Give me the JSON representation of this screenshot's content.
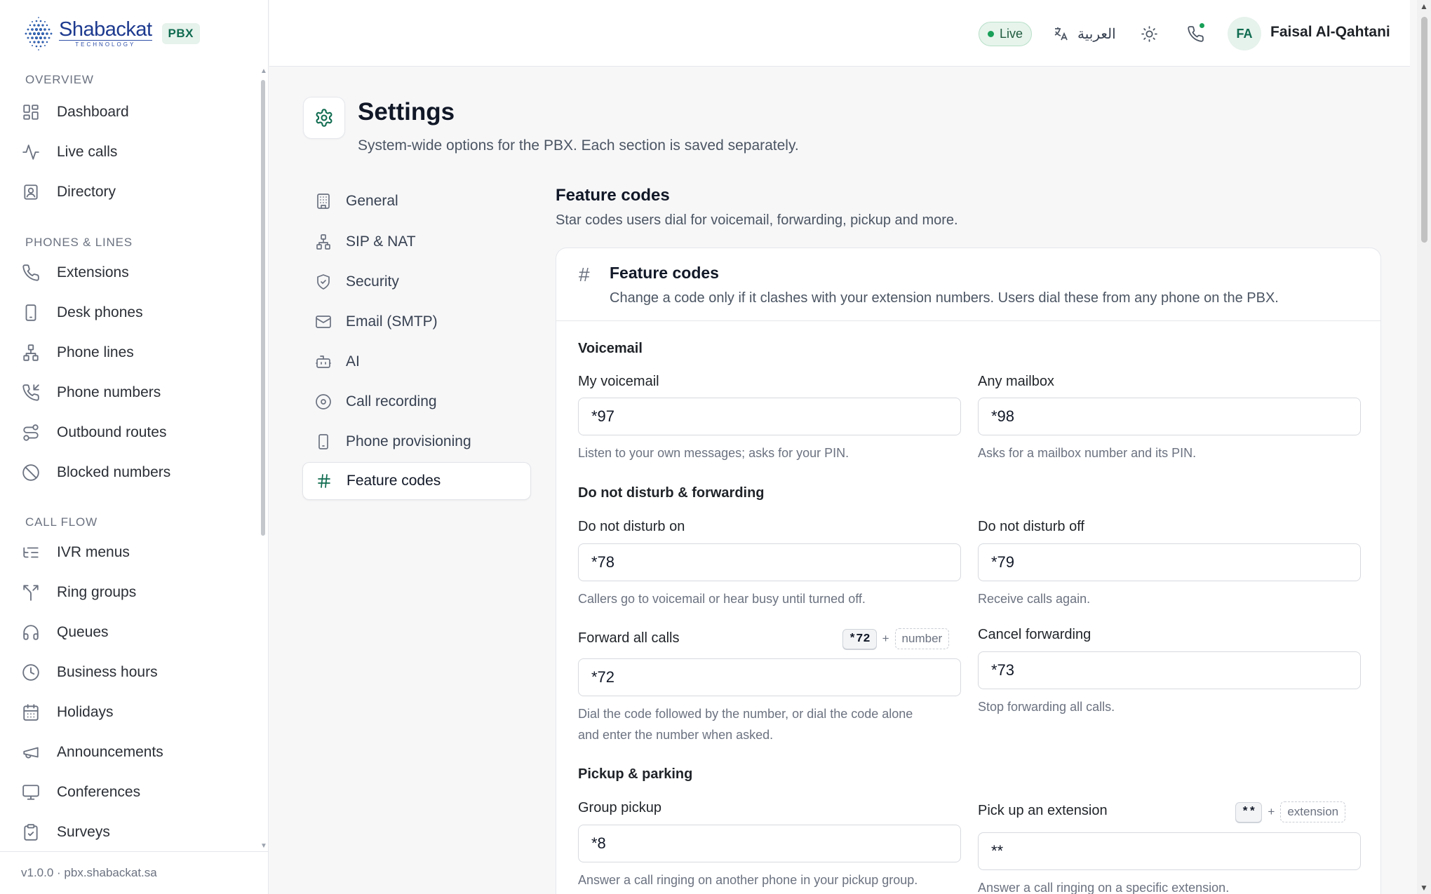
{
  "brand": {
    "name": "Shabackat",
    "sub": "TECHNOLOGY",
    "badge": "PBX"
  },
  "sidebar": {
    "sections": [
      {
        "title": "OVERVIEW",
        "items": [
          {
            "label": "Dashboard",
            "icon": "dashboard-icon"
          },
          {
            "label": "Live calls",
            "icon": "activity-icon"
          },
          {
            "label": "Directory",
            "icon": "contact-book-icon"
          }
        ]
      },
      {
        "title": "PHONES & LINES",
        "items": [
          {
            "label": "Extensions",
            "icon": "phone-icon"
          },
          {
            "label": "Desk phones",
            "icon": "desk-phone-icon"
          },
          {
            "label": "Phone lines",
            "icon": "network-icon"
          },
          {
            "label": "Phone numbers",
            "icon": "phone-incoming-icon"
          },
          {
            "label": "Outbound routes",
            "icon": "route-icon"
          },
          {
            "label": "Blocked numbers",
            "icon": "ban-icon"
          }
        ]
      },
      {
        "title": "CALL FLOW",
        "items": [
          {
            "label": "IVR menus",
            "icon": "list-tree-icon"
          },
          {
            "label": "Ring groups",
            "icon": "split-icon"
          },
          {
            "label": "Queues",
            "icon": "headphones-icon"
          },
          {
            "label": "Business hours",
            "icon": "clock-icon"
          },
          {
            "label": "Holidays",
            "icon": "calendar-icon"
          },
          {
            "label": "Announcements",
            "icon": "megaphone-icon"
          },
          {
            "label": "Conferences",
            "icon": "presentation-icon"
          },
          {
            "label": "Surveys",
            "icon": "clipboard-check-icon"
          }
        ]
      }
    ],
    "footer": "v1.0.0 · pbx.shabackat.sa"
  },
  "topbar": {
    "live": "Live",
    "language": "العربية",
    "avatar_initials": "FA",
    "user_name": "Faisal Al-Qahtani"
  },
  "page": {
    "title": "Settings",
    "subtitle": "System-wide options for the PBX. Each section is saved separately."
  },
  "settings_nav": [
    {
      "label": "General",
      "icon": "building-icon"
    },
    {
      "label": "SIP & NAT",
      "icon": "network-icon"
    },
    {
      "label": "Security",
      "icon": "shield-check-icon"
    },
    {
      "label": "Email (SMTP)",
      "icon": "mail-icon"
    },
    {
      "label": "AI",
      "icon": "bot-icon"
    },
    {
      "label": "Call recording",
      "icon": "record-icon"
    },
    {
      "label": "Phone provisioning",
      "icon": "smartphone-icon"
    },
    {
      "label": "Feature codes",
      "icon": "hash-icon",
      "active": true
    }
  ],
  "content": {
    "title": "Feature codes",
    "subtitle": "Star codes users dial for voicemail, forwarding, pickup and more.",
    "card": {
      "title": "Feature codes",
      "subtitle": "Change a code only if it clashes with your extension numbers. Users dial these from any phone on the PBX.",
      "groups": {
        "voicemail": {
          "title": "Voicemail",
          "my_voicemail": {
            "label": "My voicemail",
            "value": "*97",
            "help": "Listen to your own messages; asks for your PIN."
          },
          "any_mailbox": {
            "label": "Any mailbox",
            "value": "*98",
            "help": "Asks for a mailbox number and its PIN."
          }
        },
        "dnd": {
          "title": "Do not disturb & forwarding",
          "dnd_on": {
            "label": "Do not disturb on",
            "value": "*78",
            "help": "Callers go to voicemail or hear busy until turned off."
          },
          "dnd_off": {
            "label": "Do not disturb off",
            "value": "*79",
            "help": "Receive calls again."
          },
          "forward_all": {
            "label": "Forward all calls",
            "value": "*72",
            "hint_code": "*72",
            "hint_plus": "+",
            "hint_arg": "number",
            "help_line1": "Dial the code followed by the number, or dial the code alone",
            "help_line2": "and enter the number when asked."
          },
          "cancel_forward": {
            "label": "Cancel forwarding",
            "value": "*73",
            "help": "Stop forwarding all calls."
          }
        },
        "pickup": {
          "title": "Pickup & parking",
          "group_pickup": {
            "label": "Group pickup",
            "value": "*8",
            "help": "Answer a call ringing on another phone in your pickup group."
          },
          "pickup_ext": {
            "label": "Pick up an extension",
            "value": "**",
            "hint_code": "**",
            "hint_plus": "+",
            "hint_arg": "extension",
            "help": "Answer a call ringing on a specific extension."
          }
        }
      }
    }
  },
  "colors": {
    "accent": "#0f6b4f",
    "live": "#18a058",
    "brand": "#1d3a8f"
  }
}
